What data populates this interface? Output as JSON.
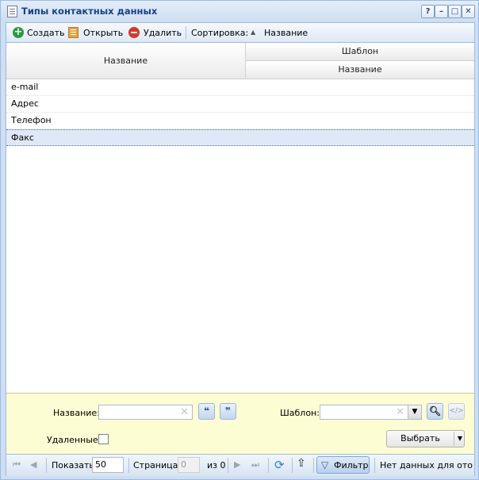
{
  "window": {
    "title": "Типы контактных данных",
    "controls": [
      "?",
      "–",
      "□",
      "✕"
    ]
  },
  "toolbar": {
    "create_label": "Создать",
    "open_label": "Открыть",
    "delete_label": "Удалить",
    "sort_label": "Сортировка:",
    "sort_field": "Название"
  },
  "grid": {
    "col_name": "Название",
    "col_template_group": "Шаблон",
    "col_template_name": "Название",
    "rows": [
      {
        "name": "e-mail",
        "template": ""
      },
      {
        "name": "Адрес",
        "template": ""
      },
      {
        "name": "Телефон",
        "template": ""
      },
      {
        "name": "Факс",
        "template": "",
        "selected": true
      }
    ]
  },
  "filter": {
    "name_label": "Название:",
    "name_value": "",
    "template_label": "Шаблон:",
    "template_value": "",
    "deleted_label": "Удаленные:",
    "deleted_checked": false,
    "quote_open": "❝",
    "quote_close": "❞",
    "code_symbol": "</>",
    "select_button": "Выбрать"
  },
  "pager": {
    "show_label": "Показать",
    "page_size": "50",
    "page_label": "Страница",
    "page_value": "0",
    "of_label": "из 0",
    "filter_button": "Фильтр",
    "status_text": "Нет данных для отображения"
  },
  "colors": {
    "title_text": "#15428b",
    "border": "#99bbe8",
    "filter_bg": "#fdfdd4",
    "selected_row": "#dfe8f6"
  }
}
